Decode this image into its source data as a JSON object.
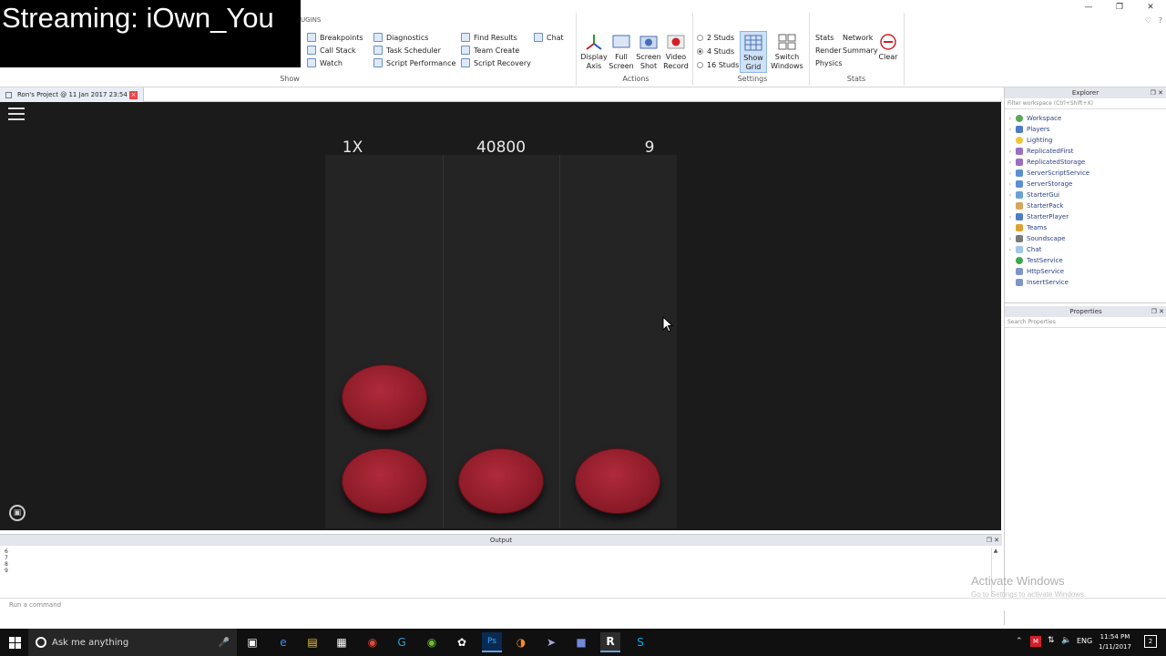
{
  "stream_overlay": "Streaming: iOwn_You",
  "ribbon": {
    "plugins_tab": "UGINS",
    "show_group": {
      "label": "Show",
      "items": [
        "Breakpoints",
        "Call Stack",
        "Watch",
        "Diagnostics",
        "Task Scheduler",
        "Script Performance",
        "Find Results",
        "Team Create",
        "Script Recovery",
        "Chat"
      ]
    },
    "actions_group": {
      "label": "Actions",
      "items": [
        "Display Axis",
        "Full Screen",
        "Screen Shot",
        "Video Record"
      ]
    },
    "settings_group": {
      "label": "Settings",
      "studs": [
        "2 Studs",
        "4 Studs",
        "16 Studs"
      ],
      "show_grid": "Show Grid",
      "switch_windows": "Switch Windows"
    },
    "stats_group": {
      "label": "Stats",
      "items": [
        "Stats",
        "Network",
        "Render",
        "Summary",
        "Physics"
      ],
      "clear": "Clear"
    }
  },
  "document_tab": "Ron's Project @ 11 Jan 2017 23:54",
  "game": {
    "multiplier": "1X",
    "score": "40800",
    "combo": "9"
  },
  "explorer": {
    "title": "Explorer",
    "filter_placeholder": "Filter workspace (Ctrl+Shift+X)",
    "items": [
      "Workspace",
      "Players",
      "Lighting",
      "ReplicatedFirst",
      "ReplicatedStorage",
      "ServerScriptService",
      "ServerStorage",
      "StarterGui",
      "StarterPack",
      "StarterPlayer",
      "Teams",
      "Soundscape",
      "Chat",
      "TestService",
      "HttpService",
      "InsertService"
    ],
    "colors": {
      "link": "#2a3f86"
    }
  },
  "properties": {
    "title": "Properties",
    "search_placeholder": "Search Properties"
  },
  "output": {
    "title": "Output",
    "lines": [
      "6",
      "7",
      "8",
      "9"
    ]
  },
  "command_bar": {
    "placeholder": "Run a command"
  },
  "watermark": {
    "title": "Activate Windows",
    "subtitle": "Go to Settings to activate Windows."
  },
  "taskbar": {
    "search_placeholder": "Ask me anything",
    "language": "ENG",
    "time": "11:54 PM",
    "date": "1/11/2017",
    "notifications": "2"
  }
}
